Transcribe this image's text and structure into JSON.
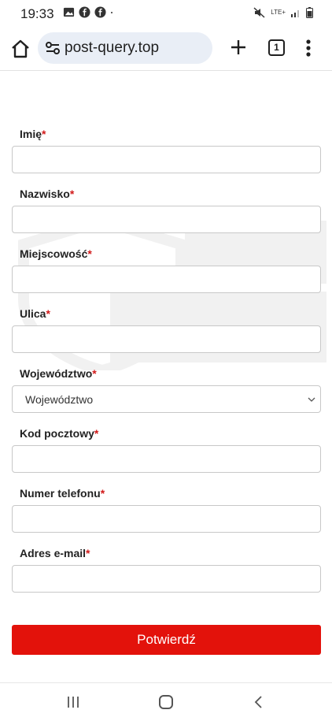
{
  "status_bar": {
    "time": "19:33",
    "network_label": "LTE+"
  },
  "browser": {
    "url": "post-query.top",
    "tab_count": "1"
  },
  "form": {
    "fields": [
      {
        "label": "Imię",
        "required_mark": "*",
        "value": ""
      },
      {
        "label": "Nazwisko",
        "required_mark": "*",
        "value": ""
      },
      {
        "label": "Miejscowość",
        "required_mark": "*",
        "value": ""
      },
      {
        "label": "Ulica",
        "required_mark": "*",
        "value": ""
      },
      {
        "label": "Województwo",
        "required_mark": "*",
        "selected": "Województwo"
      },
      {
        "label": "Kod pocztowy",
        "required_mark": "*",
        "value": ""
      },
      {
        "label": "Numer telefonu",
        "required_mark": "*",
        "value": ""
      },
      {
        "label": "Adres e-mail",
        "required_mark": "*",
        "value": ""
      }
    ],
    "submit_label": "Potwierdź",
    "accent_color": "#e3120b"
  },
  "icons": {
    "home": "home-icon",
    "tune": "site-info-icon",
    "new_tab": "plus-icon",
    "menu": "more-vert-icon",
    "recents": "recent-apps-icon",
    "nav_home": "nav-home-icon",
    "back": "back-icon"
  }
}
